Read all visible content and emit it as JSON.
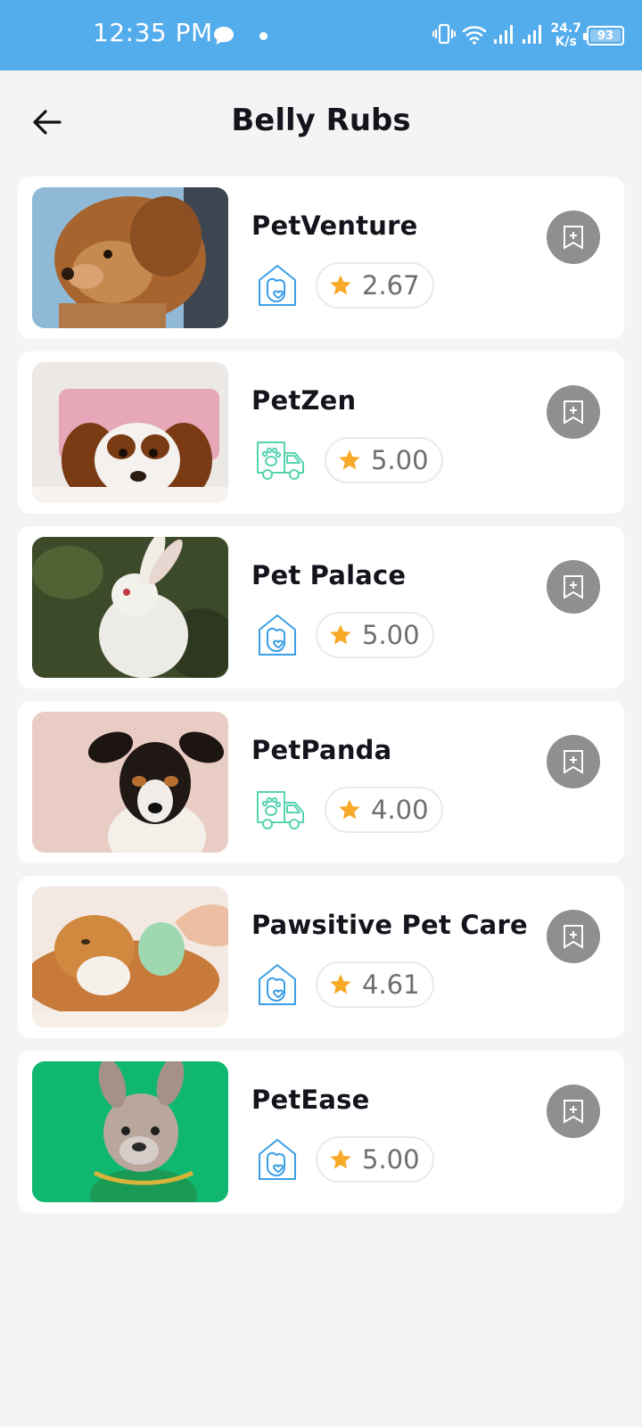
{
  "status_bar": {
    "time": "12:35 PM",
    "speed_value": "24.7",
    "speed_unit": "K/s",
    "battery": "93"
  },
  "header": {
    "title": "Belly Rubs",
    "back_icon": "arrow-left-icon"
  },
  "colors": {
    "status_bar": "#53aceb",
    "house_icon": "#3a9ee6",
    "van_icon": "#57d3b0",
    "star": "#f7a928",
    "bookmark_button": "#8f8f8f"
  },
  "providers": [
    {
      "name": "PetVenture",
      "service_type": "house",
      "rating": "2.67",
      "photo": "dog-in-car-window"
    },
    {
      "name": "PetZen",
      "service_type": "van",
      "rating": "5.00",
      "photo": "puppy-on-pink-pillow"
    },
    {
      "name": "Pet Palace",
      "service_type": "house",
      "rating": "5.00",
      "photo": "white-rabbit"
    },
    {
      "name": "PetPanda",
      "service_type": "van",
      "rating": "4.00",
      "photo": "jack-russell-terrier"
    },
    {
      "name": "Pawsitive Pet Care",
      "service_type": "house",
      "rating": "4.61",
      "photo": "cat-being-brushed"
    },
    {
      "name": "PetEase",
      "service_type": "house",
      "rating": "5.00",
      "photo": "french-bulldog-green-background"
    }
  ]
}
